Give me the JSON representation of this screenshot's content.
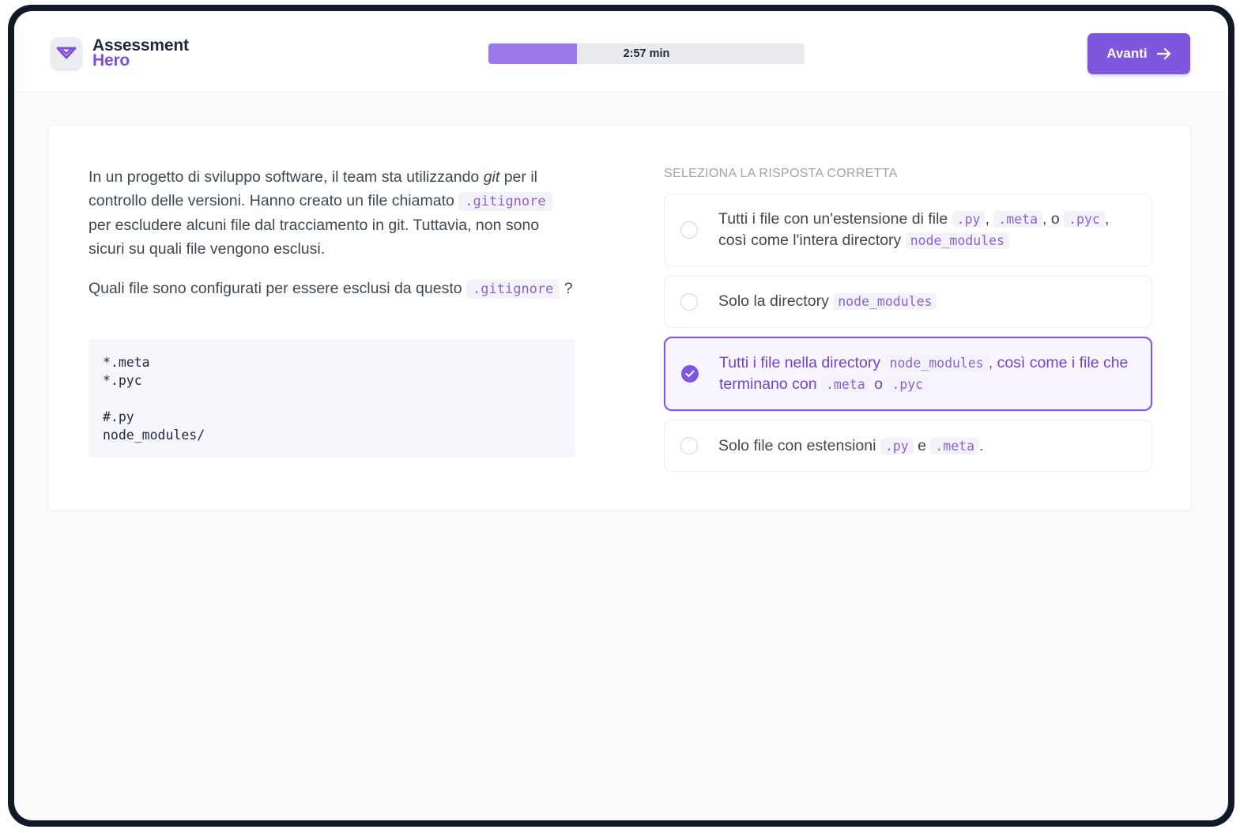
{
  "app": {
    "logo_line1": "Assessment",
    "logo_line2": "Hero",
    "brand_color": "#7f56de"
  },
  "timer": {
    "label": "2:57 min",
    "progress_fraction": 0.28
  },
  "header": {
    "next_label": "Avanti"
  },
  "question": {
    "p1_part1": "In un progetto di sviluppo software, il team sta utilizzando ",
    "p1_italic": "git",
    "p1_part2": " per il controllo delle versioni. Hanno creato un file chiamato ",
    "p1_code": ".gitignore",
    "p1_part3": " per escludere alcuni file dal tracciamento in git. Tuttavia, non sono sicuri su quali file vengono esclusi.",
    "p2_part1": "Quali file sono configurati per essere esclusi da questo ",
    "p2_code": ".gitignore",
    "p2_part2": " ?",
    "code_block": "*.meta\n*.pyc\n\n#.py\nnode_modules/"
  },
  "answers": {
    "title": "SELEZIONA LA RISPOSTA CORRETTA",
    "options": [
      {
        "t1": "Tutti i file con un'estensione di file ",
        "c1": ".py",
        "t2": ", ",
        "c2": ".meta",
        "t3": ", o ",
        "c3": ".pyc",
        "t4": ", così come l'intera directory ",
        "c4": "node_modules",
        "selected": false
      },
      {
        "t1": "Solo la directory ",
        "c1": "node_modules",
        "selected": false
      },
      {
        "t1": "Tutti i file nella directory ",
        "c1": "node_modules",
        "t2": ", così come i file che terminano con ",
        "c2": ".meta",
        "t3": " o ",
        "c3": ".pyc",
        "selected": true
      },
      {
        "t1": "Solo file con estensioni ",
        "c1": ".py",
        "t2": " e ",
        "c2": ".meta",
        "t3": ".",
        "selected": false
      }
    ]
  }
}
